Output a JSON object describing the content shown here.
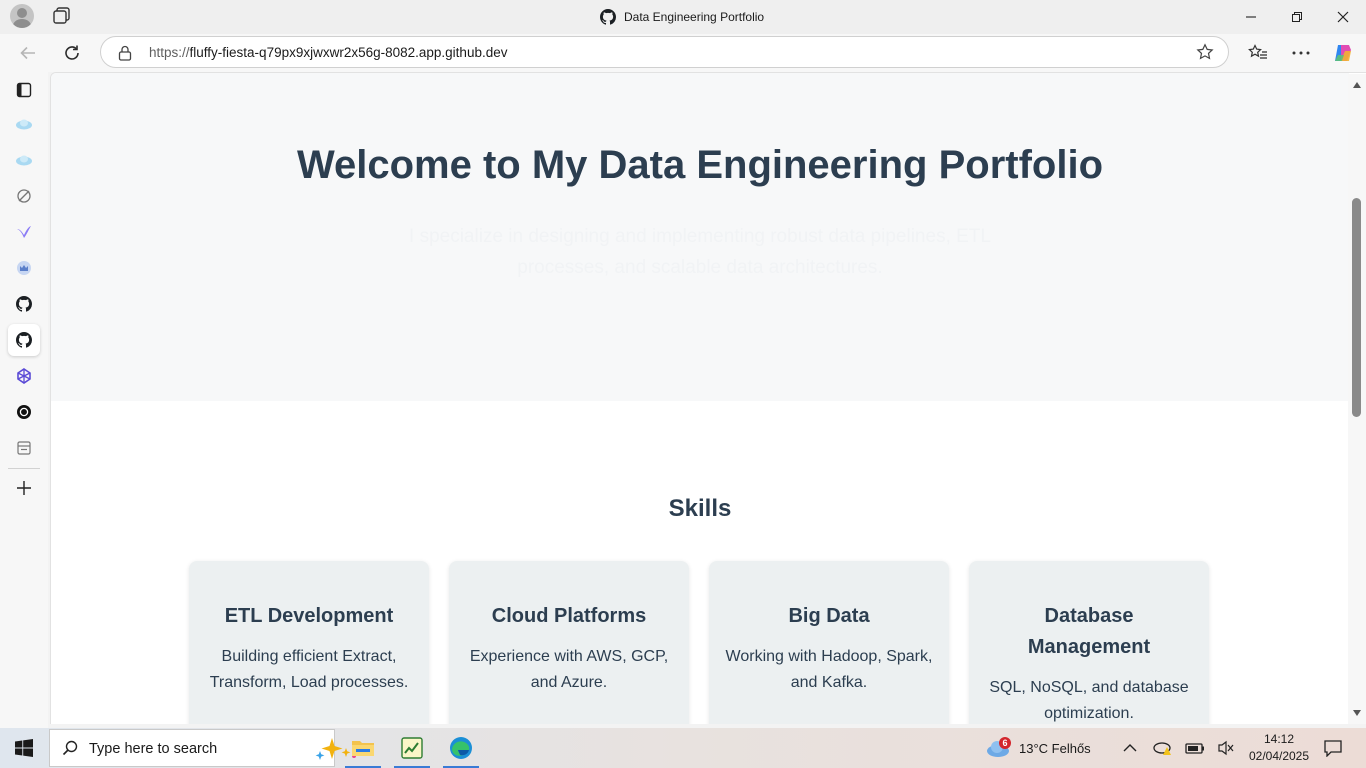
{
  "browser": {
    "window_title": "Data Engineering Portfolio",
    "url_protocol": "https://",
    "url_rest": "fluffy-fiesta-q79px9xjwxwr2x56g-8082.app.github.dev"
  },
  "sidebar": {
    "icons": [
      "tab-actions-icon",
      "cloud-icon",
      "cloud-icon",
      "compass-icon",
      "gemini-icon",
      "crown-icon",
      "github-icon",
      "github-icon-active",
      "perplexity-icon",
      "chatgpt-icon",
      "notes-icon",
      "add-icon"
    ]
  },
  "page": {
    "hero_title": "Welcome to My Data Engineering Portfolio",
    "hero_text": "I specialize in designing and implementing robust data pipelines, ETL processes, and scalable data architectures.",
    "skills_title": "Skills",
    "skills": [
      {
        "title": "ETL Development",
        "text": "Building efficient Extract, Transform, Load processes."
      },
      {
        "title": "Cloud Platforms",
        "text": "Experience with AWS, GCP, and Azure."
      },
      {
        "title": "Big Data",
        "text": "Working with Hadoop, Spark, and Kafka."
      },
      {
        "title": "Database Management",
        "text": "SQL, NoSQL, and database optimization."
      }
    ]
  },
  "taskbar": {
    "search_placeholder": "Type here to search",
    "weather_badge": "6",
    "weather_text": "13°C  Felhős",
    "time": "14:12",
    "date": "02/04/2025"
  },
  "colors": {
    "heading": "#2c3e50",
    "card_bg": "#ecf0f1",
    "hero_bg": "#f7f8f9"
  }
}
